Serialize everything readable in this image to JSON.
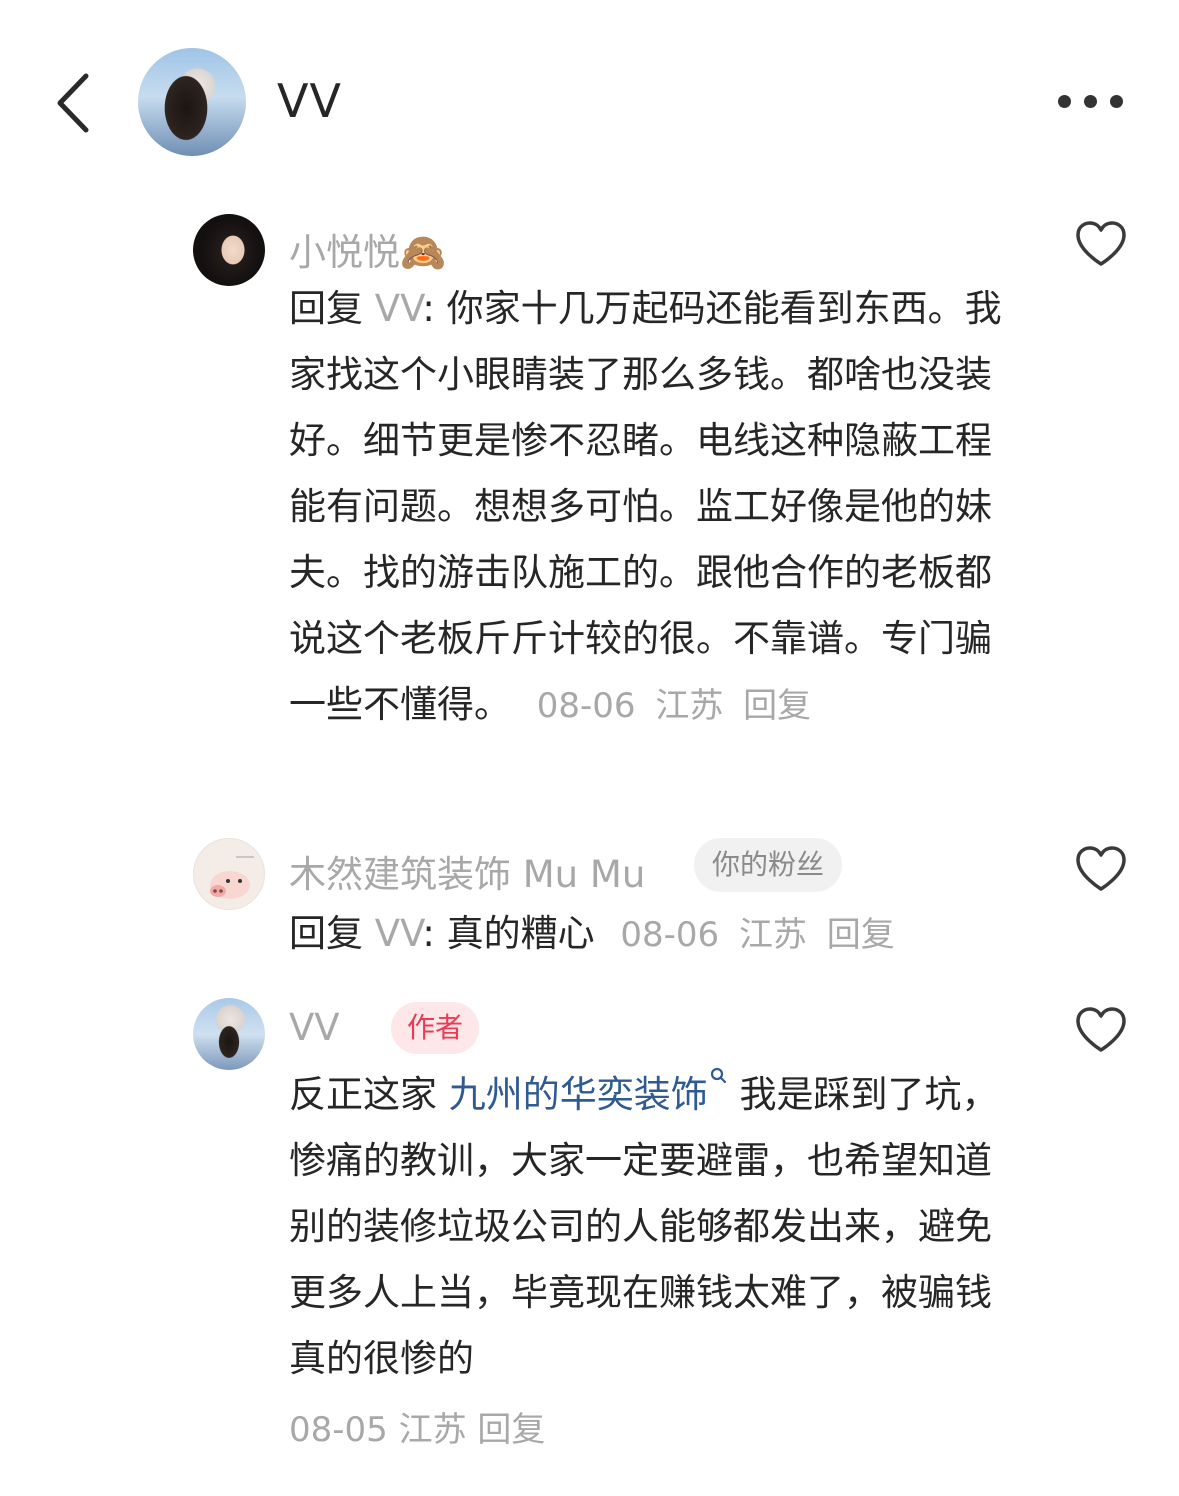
{
  "header": {
    "title": "VV",
    "back_icon": "chevron-left-icon",
    "more_icon": "more-horizontal-icon"
  },
  "comments": [
    {
      "username": "小悦悦🙈",
      "reply_prefix": "回复",
      "reply_target": "VV",
      "text": ": 你家十几万起码还能看到东西。我家找这个小眼睛装了那么多钱。都啥也没装好。细节更是惨不忍睹。电线这种隐蔽工程能有问题。想想多可怕。监工好像是他的妹夫。找的游击队施工的。跟他合作的老板都说这个老板斤斤计较的很。不靠谱。专门骗一些不懂得。",
      "date": "08-06",
      "location": "江苏",
      "reply_label": "回复"
    },
    {
      "username": "木然建筑装饰 Mu Mu",
      "tag": "你的粉丝",
      "reply_prefix": "回复",
      "reply_target": "VV",
      "text": ": 真的糟心",
      "date": "08-06",
      "location": "江苏",
      "reply_label": "回复"
    },
    {
      "username": "VV",
      "tag": "作者",
      "text_before": "反正这家 ",
      "link_text": "九州的华奕装饰",
      "text_after": " 我是踩到了坑，惨痛的教训，大家一定要避雷，也希望知道别的装修垃圾公司的人能够都发出来，避免更多人上当，毕竟现在赚钱太难了，被骗钱真的很惨的",
      "date": "08-05",
      "location": "江苏",
      "reply_label": "回复"
    }
  ],
  "colors": {
    "link": "#2f5a92",
    "author_tag_text": "#ea3a54",
    "author_tag_bg": "#fde7e9",
    "muted": "#a8a8a8"
  }
}
